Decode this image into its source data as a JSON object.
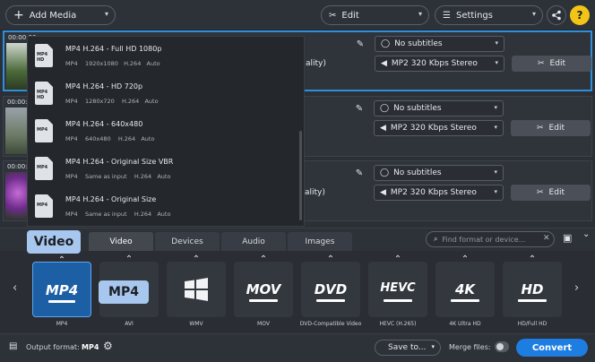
{
  "toolbar": {
    "add_media": "Add Media",
    "edit": "Edit",
    "settings": "Settings",
    "help": "?"
  },
  "files": [
    {
      "time": "00:00:00",
      "subtitles": "No subtitles",
      "audio": "MP2 320 Kbps Stereo",
      "quality_suffix": "ality)",
      "edit": "Edit"
    },
    {
      "time": "00:00:00",
      "subtitles": "No subtitles",
      "audio": "MP2 320 Kbps Stereo",
      "quality_suffix": "ality)",
      "edit": "Edit"
    },
    {
      "time": "00:00:00",
      "subtitles": "No subtitles",
      "audio": "MP2 320 Kbps Stereo",
      "quality_suffix": "ality)",
      "edit": "Edit"
    }
  ],
  "presets": [
    {
      "title": "MP4 H.264 - Full HD 1080p",
      "format": "MP4",
      "resolution": "1920x1080",
      "codec": "H.264",
      "audio": "Auto"
    },
    {
      "title": "MP4 H.264 - HD 720p",
      "format": "MP4",
      "resolution": "1280x720",
      "codec": "H.264",
      "audio": "Auto"
    },
    {
      "title": "MP4 H.264 - 640x480",
      "format": "MP4",
      "resolution": "640x480",
      "codec": "H.264",
      "audio": "Auto"
    },
    {
      "title": "MP4 H.264 - Original Size VBR",
      "format": "MP4",
      "resolution": "Same as input",
      "codec": "H.264",
      "audio": "Auto"
    },
    {
      "title": "MP4 H.264 - Original Size",
      "format": "MP4",
      "resolution": "Same as input",
      "codec": "H.264",
      "audio": "Auto"
    }
  ],
  "preset_icon_text": [
    "MP4 HD",
    "MP4 HD",
    "MP4",
    "MP4",
    "MP4"
  ],
  "tabs": [
    "Video",
    "Devices",
    "Audio",
    "Images"
  ],
  "search_placeholder": "Find format or device...",
  "tooltips": {
    "video": "Video",
    "mp4": "MP4"
  },
  "formats": [
    {
      "logo": "MP4",
      "label": "MP4"
    },
    {
      "logo": "AVI",
      "label": "AVI"
    },
    {
      "logo": "WMV",
      "label": "WMV"
    },
    {
      "logo": "MOV",
      "label": "MOV"
    },
    {
      "logo": "DVD",
      "label": "DVD-Compatible Video"
    },
    {
      "logo": "HEVC",
      "label": "HEVC (H.265)"
    },
    {
      "logo": "4K",
      "label": "4K Ultra HD"
    },
    {
      "logo": "HD",
      "label": "HD/Full HD"
    }
  ],
  "bottom": {
    "output_label": "Output format:",
    "output_value": "MP4",
    "save_to": "Save to...",
    "merge_files": "Merge files:",
    "convert": "Convert"
  },
  "colors": {
    "accent": "#1e7de0",
    "tooltip": "#a7c7ee",
    "help": "#f2c418"
  }
}
